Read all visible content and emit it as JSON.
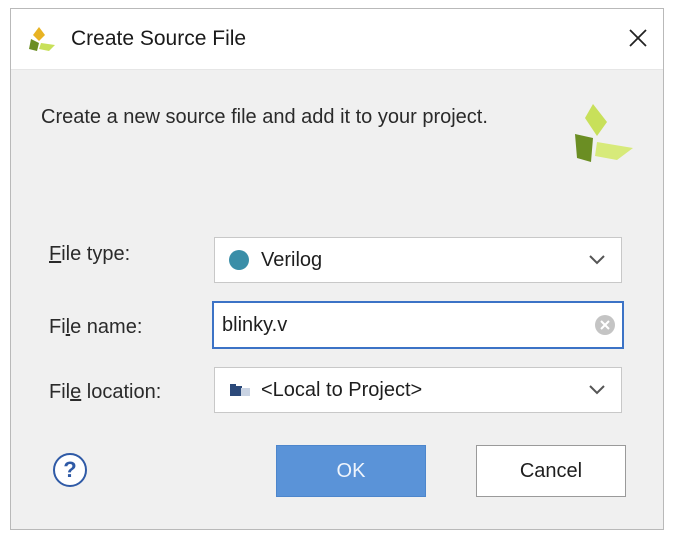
{
  "window": {
    "title": "Create Source File"
  },
  "description": "Create a new source file and add it to your project.",
  "fields": {
    "file_type": {
      "label_prefix": "",
      "label_mnemonic": "F",
      "label_rest": "ile type:",
      "value": "Verilog",
      "dot_color": "#3a8ea8"
    },
    "file_name": {
      "label_prefix": "Fi",
      "label_mnemonic": "l",
      "label_rest": "e name:",
      "value": "blinky.v"
    },
    "file_location": {
      "label_prefix": "Fil",
      "label_mnemonic": "e",
      "label_rest": " location:",
      "value": "<Local to Project>"
    }
  },
  "buttons": {
    "help": "?",
    "ok": "OK",
    "cancel": "Cancel"
  },
  "colors": {
    "accent": "#3c73c6",
    "ok_button": "#5a93d8",
    "logo_dark": "#6b8e23",
    "logo_light": "#c8e05a"
  },
  "icons": {
    "app_logo": "xilinx-vivado-logo",
    "close": "close-icon",
    "dropdown": "chevron-down-icon",
    "clear": "clear-input-icon",
    "location": "folder-icon"
  }
}
